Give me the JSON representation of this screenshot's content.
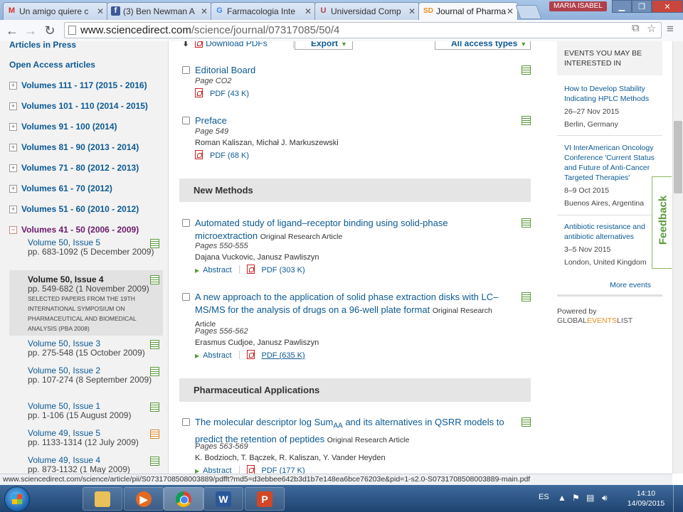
{
  "browser": {
    "tabs": [
      {
        "label": "Un amigo quiere c",
        "icon": "M",
        "icon_color": "#d93025"
      },
      {
        "label": "(3) Ben Newman A",
        "icon": "f",
        "icon_color": "#3b5998"
      },
      {
        "label": "Farmacologia Inte",
        "icon": "G",
        "icon_color": "#4285f4"
      },
      {
        "label": "Universidad Comp",
        "icon": "U",
        "icon_color": "#b0404a"
      },
      {
        "label": "Journal of Pharma",
        "icon": "SD",
        "icon_color": "#f08a1c"
      }
    ],
    "user": "MARIA ISABEL",
    "url_host": "www.sciencedirect.com",
    "url_path": "/science/journal/07317085/50/4",
    "status_url": "www.sciencedirect.com/science/article/pii/S0731708508003889/pdfft?md5=d3ebbee642b3d1b7e148ea6bce76203e&pid=1-s2.0-S0731708508003889-main.pdf"
  },
  "sidebar": {
    "articles_in_press": "Articles in Press",
    "open_access": "Open Access articles",
    "volumes": [
      {
        "label": "Volumes 111 - 117 (2015 - 2016)",
        "toggle": "+"
      },
      {
        "label": "Volumes 101 - 110 (2014 - 2015)",
        "toggle": "+"
      },
      {
        "label": "Volumes 91 - 100 (2014)",
        "toggle": "+"
      },
      {
        "label": "Volumes 81 - 90 (2013 - 2014)",
        "toggle": "+"
      },
      {
        "label": "Volumes 71 - 80 (2012 - 2013)",
        "toggle": "+"
      },
      {
        "label": "Volumes 61 - 70 (2012)",
        "toggle": "+"
      },
      {
        "label": "Volumes 51 - 60 (2010 - 2012)",
        "toggle": "+"
      },
      {
        "label": "Volumes 41 - 50 (2006 - 2009)",
        "toggle": "−"
      }
    ],
    "issues": [
      {
        "title": "Volume 50, Issue 5",
        "pages": "pp. 683-1092 (5 December 2009)",
        "note": ""
      },
      {
        "title": "Volume 50, Issue 4",
        "pages": "pp. 549-682 (1 November 2009)",
        "note": "SELECTED PAPERS FROM THE 19TH INTERNATIONAL SYMPOSIUM ON PHARMACEUTICAL AND BIOMEDICAL ANALYSIS (PBA 2008)"
      },
      {
        "title": "Volume 50, Issue 3",
        "pages": "pp. 275-548 (15 October 2009)",
        "note": ""
      },
      {
        "title": "Volume 50, Issue 2",
        "pages": "pp. 107-274 (8 September 2009)",
        "note": ""
      },
      {
        "title": "Volume 50, Issue 1",
        "pages": "pp. 1-106 (15 August 2009)",
        "note": ""
      },
      {
        "title": "Volume 49, Issue 5",
        "pages": "pp. 1133-1314 (12 July 2009)",
        "note": ""
      },
      {
        "title": "Volume 49, Issue 4",
        "pages": "pp. 873-1132 (1 May 2009)",
        "note": ""
      }
    ]
  },
  "toolbar": {
    "download_pdfs": "Download PDFs",
    "export": "Export",
    "access": "All access types"
  },
  "articles": {
    "editorial": {
      "title": "Editorial Board",
      "page": "Page CO2",
      "pdf": "PDF (43 K)"
    },
    "preface": {
      "title": "Preface",
      "page": "Page 549",
      "authors": "Roman Kaliszan, Michał J. Markuszewski",
      "pdf": "PDF (68 K)"
    },
    "section_new_methods": "New Methods",
    "a1": {
      "title": "Automated study of ligand–receptor binding using solid-phase microextraction",
      "type": "Original Research Article",
      "pages": "Pages 550-555",
      "authors": "Dajana Vuckovic, Janusz Pawliszyn",
      "abstract": "Abstract",
      "pdf": "PDF (303 K)"
    },
    "a2": {
      "title": "A new approach to the application of solid phase extraction disks with LC–MS/MS for the analysis of drugs on a 96-well plate format",
      "type": "Original Research Article",
      "pages": "Pages 556-562",
      "authors": "Erasmus Cudjoe, Janusz Pawliszyn",
      "abstract": "Abstract",
      "pdf": "PDF (635 K)"
    },
    "section_pharma": "Pharmaceutical Applications",
    "a3": {
      "title_pre": "The molecular descriptor log Sum",
      "title_sub": "AA",
      "title_post": " and its alternatives in QSRR models to predict the retention of peptides",
      "type": "Original Research Article",
      "pages": "Pages 563-569",
      "authors": "K. Bodzioch, T. Bączek, R. Kaliszan, Y. Vander Heyden",
      "abstract": "Abstract",
      "pdf": "PDF (177 K)"
    }
  },
  "events": {
    "heading": "EVENTS YOU MAY BE INTERESTED IN",
    "items": [
      {
        "title": "How to Develop Stability Indicating HPLC Methods",
        "date": "26–27 Nov 2015",
        "place": "Berlin, Germany"
      },
      {
        "title": "VI InterAmerican Oncology Conference 'Current Status and Future of Anti-Cancer Targeted Therapies'",
        "date": "8–9 Oct 2015",
        "place": "Buenos Aires, Argentina"
      },
      {
        "title": "Antibiotic resistance and antibiotic alternatives",
        "date": "3–5 Nov 2015",
        "place": "London, United Kingdom"
      }
    ],
    "more": "More events",
    "powered_by": "Powered by",
    "brand_global": "GLOBAL",
    "brand_events": "EVENTS",
    "brand_list": "LIST",
    "feedback": "Feedback"
  },
  "taskbar": {
    "lang": "ES",
    "time": "14:10",
    "date": "14/09/2015"
  }
}
